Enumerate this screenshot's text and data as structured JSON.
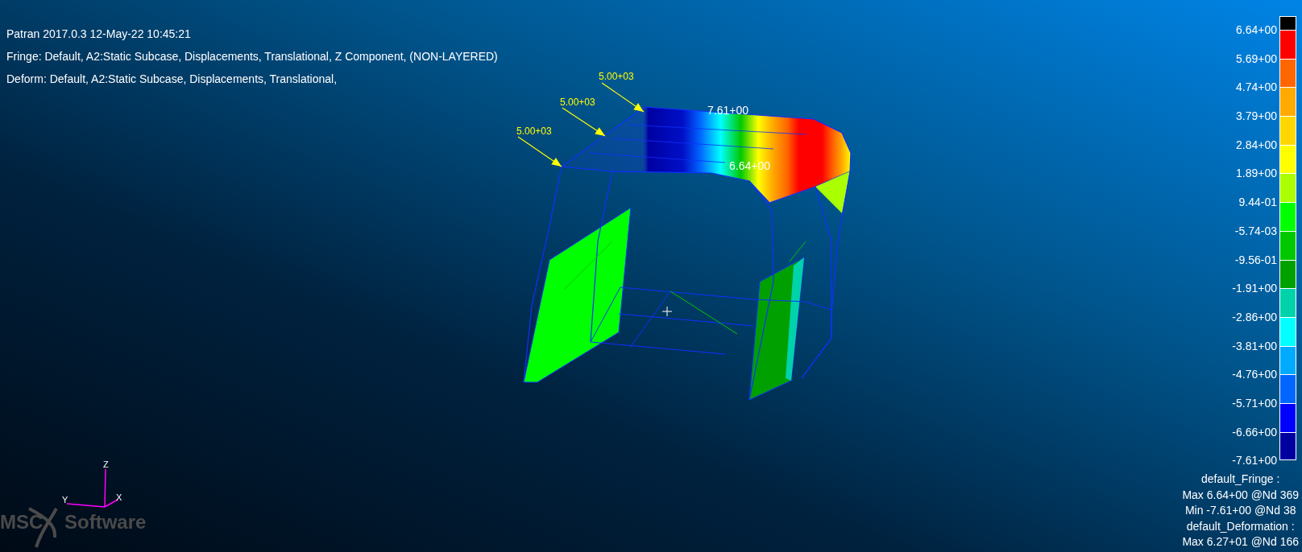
{
  "header": [
    "Patran 2017.0.3 12-May-22 10:45:21",
    "Fringe: Default, A2:Static Subcase, Displacements, Translational, Z Component, (NON-LAYERED)",
    "Deform: Default, A2:Static Subcase, Displacements, Translational,"
  ],
  "load_labels": [
    "5.00+03",
    "5.00+03",
    "5.00+03"
  ],
  "fringe_labels": [
    "7.61+00",
    "6.64+00"
  ],
  "axis_labels": [
    "Z",
    "Y",
    "X"
  ],
  "logo": [
    "MSC",
    "Software"
  ],
  "legend": [
    {
      "color": "#000000",
      "label": "6.64+00"
    },
    {
      "color": "#ff0000",
      "label": "5.69+00"
    },
    {
      "color": "#ff6600",
      "label": "4.74+00"
    },
    {
      "color": "#ffaa00",
      "label": "3.79+00"
    },
    {
      "color": "#ffd700",
      "label": "2.84+00"
    },
    {
      "color": "#ffff00",
      "label": "1.89+00"
    },
    {
      "color": "#aaff00",
      "label": "9.44-01"
    },
    {
      "color": "#00ff00",
      "label": "-5.74-03"
    },
    {
      "color": "#00c800",
      "label": "-9.56-01"
    },
    {
      "color": "#00a000",
      "label": "-1.91+00"
    },
    {
      "color": "#00d2aa",
      "label": "-2.86+00"
    },
    {
      "color": "#00ffff",
      "label": "-3.81+00"
    },
    {
      "color": "#00aaff",
      "label": "-4.76+00"
    },
    {
      "color": "#0066ff",
      "label": "-5.71+00"
    },
    {
      "color": "#0000ff",
      "label": "-6.66+00"
    },
    {
      "color": "#0000a0",
      "label": "-7.61+00"
    }
  ],
  "summary": [
    "default_Fringe :",
    "Max 6.64+00 @Nd 369",
    "Min -7.61+00 @Nd 38",
    "default_Deformation :",
    "Max 6.27+01 @Nd 166"
  ]
}
